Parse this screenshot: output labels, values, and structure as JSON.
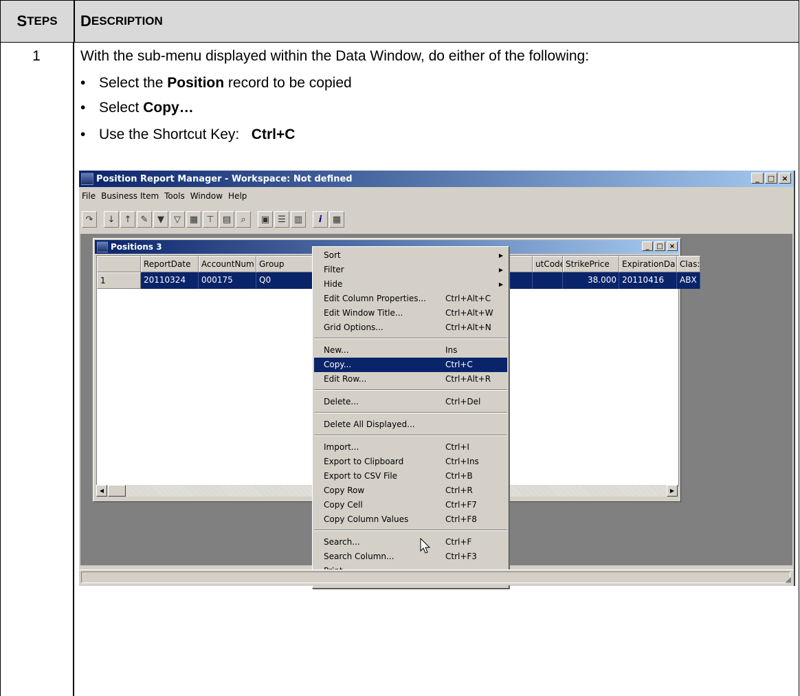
{
  "table": {
    "header_steps_first": "S",
    "header_steps_rest": "TEPS",
    "header_desc_first": "D",
    "header_desc_rest": "ESCRIPTION",
    "step_number": "1",
    "intro": "With the sub-menu displayed within the Data Window, do either of the following:",
    "bullet_char": "•",
    "bullets": [
      {
        "pre": "Select the ",
        "bold": "Position",
        "post": " record to be copied"
      },
      {
        "pre": "Select ",
        "bold": "Copy…",
        "post": ""
      },
      {
        "pre": "Use the Shortcut Key:   ",
        "bold": "Ctrl+C",
        "post": ""
      }
    ]
  },
  "app": {
    "title": "Position Report Manager - Workspace: Not defined",
    "window_buttons": [
      "_",
      "□",
      "×"
    ],
    "menu": [
      "File",
      "Business Item",
      "Tools",
      "Window",
      "Help"
    ],
    "toolbar_icons": [
      "refresh-icon",
      "sort-asc-icon",
      "sort-desc-icon",
      "sort-custom-icon",
      "filter-icon",
      "filter-edit-icon",
      "grid-icon",
      "pin-icon",
      "print-icon",
      "find-icon",
      "layout1-icon",
      "layout2-icon",
      "layout3-icon",
      "info-icon",
      "columns-icon"
    ]
  },
  "child": {
    "title": "Positions 3",
    "columns": [
      "",
      "ReportDate",
      "AccountNum",
      "Group",
      "",
      "utCode",
      "StrikePrice",
      "ExpirationDa",
      "Clas:"
    ],
    "row": {
      "num": "1",
      "report_date": "20110324",
      "account": "000175",
      "group": "Q0",
      "strike": "38.000",
      "expiration": "20110416",
      "class": "ABX"
    }
  },
  "context_menu": {
    "items": [
      {
        "label": "Sort",
        "key": "",
        "submenu": true
      },
      {
        "label": "Filter",
        "key": "",
        "submenu": true
      },
      {
        "label": "Hide",
        "key": "",
        "submenu": true
      },
      {
        "label": "Edit Column Properties...",
        "key": "Ctrl+Alt+C"
      },
      {
        "label": "Edit Window Title...",
        "key": "Ctrl+Alt+W"
      },
      {
        "label": "Grid Options...",
        "key": "Ctrl+Alt+N"
      },
      {
        "label": "New...",
        "key": "Ins"
      },
      {
        "label": "Copy...",
        "key": "Ctrl+C",
        "selected": true
      },
      {
        "label": "Edit Row...",
        "key": "Ctrl+Alt+R"
      },
      {
        "label": "Delete...",
        "key": "Ctrl+Del"
      },
      {
        "label": "Delete All Displayed...",
        "key": ""
      },
      {
        "label": "Import...",
        "key": "Ctrl+I"
      },
      {
        "label": "Export to Clipboard",
        "key": "Ctrl+Ins"
      },
      {
        "label": "Export to CSV File",
        "key": "Ctrl+B"
      },
      {
        "label": "Copy Row",
        "key": "Ctrl+R"
      },
      {
        "label": "Copy Cell",
        "key": "Ctrl+F7"
      },
      {
        "label": "Copy Column Values",
        "key": "Ctrl+F8"
      },
      {
        "label": "Search...",
        "key": "Ctrl+F"
      },
      {
        "label": "Search Column...",
        "key": "Ctrl+F3"
      },
      {
        "label": "Print...",
        "key": ""
      }
    ]
  }
}
